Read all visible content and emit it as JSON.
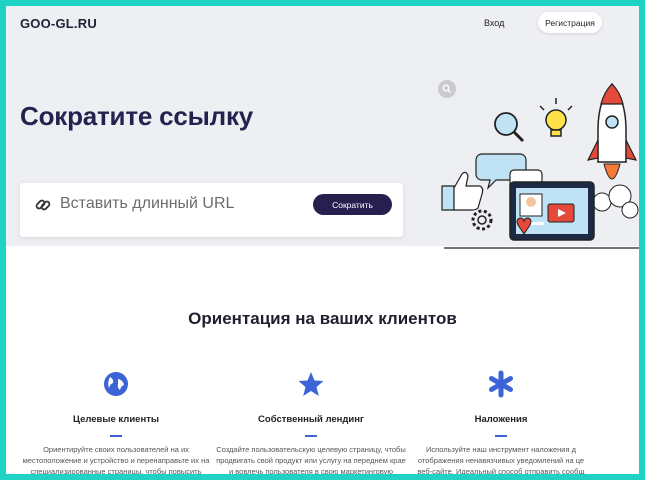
{
  "header": {
    "logo": "GOO-GL.RU",
    "login": "Вход",
    "register": "Регистрация"
  },
  "hero": {
    "title": "Сократите ссылку",
    "url_placeholder": "Вставить длинный URL",
    "shorten_button": "Сократить"
  },
  "section": {
    "title": "Ориентация на ваших клиентов"
  },
  "features": [
    {
      "title": "Целевые клиенты",
      "description": "Ориентируйте своих пользователей на их\nместоположение и устройство и перенаправьте их на\nспециализированные страницы, чтобы повысить"
    },
    {
      "title": "Собственный лендинг",
      "description": "Создайте пользовательскую целевую страницу, чтобы\nпродвигать свой продукт или услугу на переднем крае\nи вовлечь пользователя в свою маркетинговую"
    },
    {
      "title": "Наложения",
      "description": "Используйте наш инструмент наложения д\nотображения ненавязчивых уведомлений на це\nвеб-сайте. Идеальный способ отправить сообщ"
    }
  ],
  "colors": {
    "accent_dark": "#26204f",
    "accent_blue": "#3d64d6",
    "frame": "#1fd3c4",
    "hero_bg": "#eeeff3"
  },
  "icons": {
    "link": "link-icon",
    "search": "search-icon",
    "globe": "globe-icon",
    "star": "star-icon",
    "asterisk": "asterisk-icon"
  }
}
